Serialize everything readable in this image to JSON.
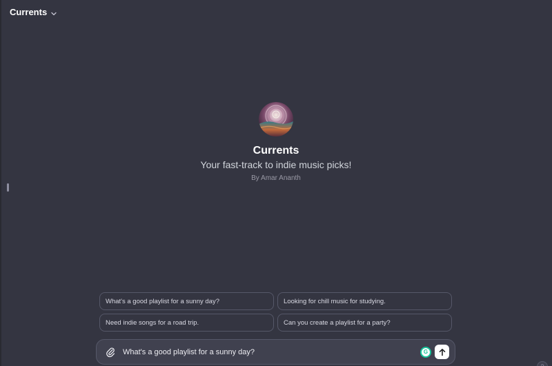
{
  "header": {
    "title": "Currents",
    "chevron_icon": "chevron-down-icon"
  },
  "hero": {
    "avatar_icon": "gpt-avatar-image",
    "title": "Currents",
    "subtitle": "Your fast-track to indie music picks!",
    "author": "By Amar Ananth"
  },
  "suggestions": [
    {
      "label": "What's a good playlist for a sunny day?"
    },
    {
      "label": "Looking for chill music for studying."
    },
    {
      "label": "Need indie songs for a road trip."
    },
    {
      "label": "Can you create a playlist for a party?"
    }
  ],
  "composer": {
    "value": "What's a good playlist for a sunny day?",
    "attach_icon": "paperclip-icon",
    "grammarly_icon": "grammarly-icon",
    "grammarly_letter": "G",
    "send_icon": "arrow-up-icon"
  },
  "help": {
    "label": "?"
  },
  "colors": {
    "background": "#343541",
    "composer": "#40414f",
    "border": "#565869",
    "grammarly": "#15c39a"
  }
}
